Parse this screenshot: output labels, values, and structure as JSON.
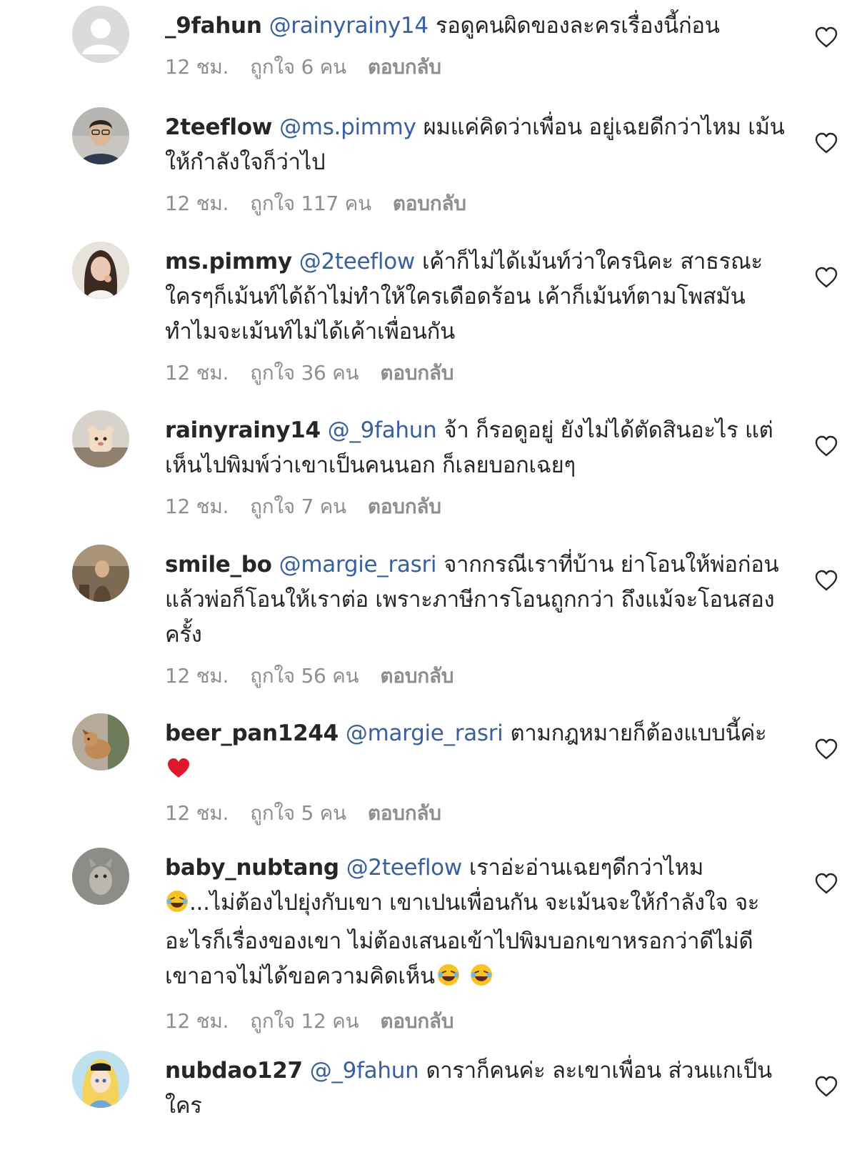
{
  "comments": [
    {
      "username": "_9fahun",
      "mention": "@rainyrainy14",
      "text": "รอดูคนผิดของละครเรื่องนี้ก่อน",
      "time": "12 ชม.",
      "likes": "ถูกใจ 6 คน",
      "reply": "ตอบกลับ",
      "avatar": "default-avatar"
    },
    {
      "username": "2teeflow",
      "mention": "@ms.pimmy",
      "text": "ผมแค่คิดว่าเพื่อน อยู่เฉยดีกว่าไหม เม้นให้กำลังใจก็ว่าไป",
      "time": "12 ชม.",
      "likes": "ถูกใจ 117 คน",
      "reply": "ตอบกลับ",
      "avatar": "photo-man"
    },
    {
      "username": "ms.pimmy",
      "mention": "@2teeflow",
      "text": "เค้าก็ไม่ได้เม้นท์ว่าใครนิคะ สาธรณะใครๆก็เม้นท์ได้ถ้าไม่ทำให้ใครเดือดร้อน เค้าก็เม้นท์ตามโพสมันทำไมจะเม้นท์ไม่ได้เค้าเพื่อนกัน",
      "time": "12 ชม.",
      "likes": "ถูกใจ 36 คน",
      "reply": "ตอบกลับ",
      "avatar": "photo-woman"
    },
    {
      "username": "rainyrainy14",
      "mention": "@_9fahun",
      "text": "จ้า ก็รอดูอยู่ ยังไม่ได้ตัดสินอะไร แต่เห็นไปพิมพ์ว่าเขาเป็นคนนอก ก็เลยบอกเฉยๆ",
      "time": "12 ชม.",
      "likes": "ถูกใจ 7 คน",
      "reply": "ตอบกลับ",
      "avatar": "photo-toy"
    },
    {
      "username": "smile_bo",
      "mention": "@margie_rasri",
      "text": "จากกรณีเราที่บ้าน ย่าโอนให้พ่อก่อน แล้วพ่อก็โอนให้เราต่อ เพราะภาษีการโอนถูกกว่า ถึงแม้จะโอนสองครั้ง",
      "time": "12 ชม.",
      "likes": "ถูกใจ 56 คน",
      "reply": "ตอบกลับ",
      "avatar": "photo-outdoor"
    },
    {
      "username": "beer_pan1244",
      "mention": "@margie_rasri",
      "text": "ตามกฎหมายก็ต้องแบบนี้ค่ะ",
      "emoji": "red-heart-emoji",
      "time": "12 ชม.",
      "likes": "ถูกใจ 5 คน",
      "reply": "ตอบกลับ",
      "avatar": "photo-dog"
    },
    {
      "username": "baby_nubtang",
      "mention": "@2teeflow",
      "text_a": "เราอ่ะอ่านเฉยๆดีกว่าไหม",
      "text_b": "...ไม่ต้องไปยุ่งกับเขา เขาเปนเพื่อนกัน จะเม้นจะให้กำลังใจ จะอะไรก็เรื่องของเขา ไม่ต้องเสนอเข้าไปพิมบอกเขาหรอกว่าดีไม่ดี เขาอาจไม่ได้ขอความคิดเห็น",
      "emoji": "laughing-emoji",
      "time": "12 ชม.",
      "likes": "ถูกใจ 12 คน",
      "reply": "ตอบกลับ",
      "avatar": "photo-cat"
    },
    {
      "username": "nubdao127",
      "mention": "@_9fahun",
      "text": "ดาราก็คนค่ะ ละเขาเพื่อน ส่วนแกเป็นใคร",
      "avatar": "photo-cartoon"
    }
  ],
  "icons": {
    "like": "heart-outline-icon"
  },
  "colors": {
    "mention": "#385f9e",
    "meta": "#8e8e8e",
    "text": "#262626"
  }
}
